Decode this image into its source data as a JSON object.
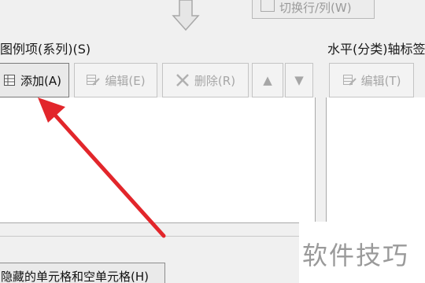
{
  "top": {
    "switch_label": "切换行/列(W)"
  },
  "legend": {
    "title": "图例项(系列)(S)",
    "add_label": "添加(A)",
    "edit_label": "编辑(E)",
    "delete_label": "删除(R)",
    "up_symbol": "▲",
    "down_symbol": "▼"
  },
  "axis": {
    "title": "水平(分类)轴标签",
    "edit_label": "编辑(T)"
  },
  "bottom": {
    "hidden_cells_label": "隐藏的单元格和空单元格(H)"
  },
  "watermark": "软件技巧",
  "colors": {
    "annotation_arrow": "#e2262b",
    "disabled_text": "#a6a6a6"
  },
  "icons": {
    "add": "table-add-icon",
    "edit": "edit-icon",
    "delete": "x-icon",
    "switch": "switch-row-column-icon",
    "arrow": "down-arrow-icon"
  }
}
